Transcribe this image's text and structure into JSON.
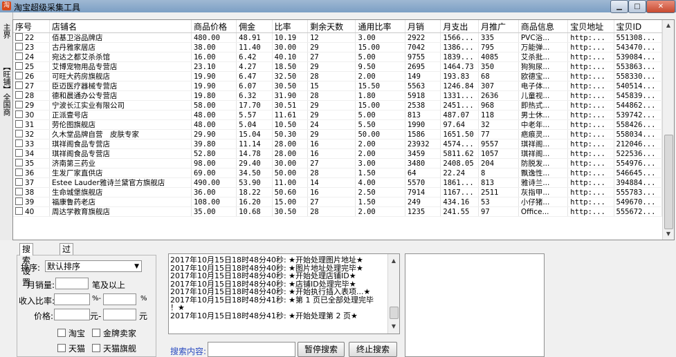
{
  "window": {
    "title": "淘宝超级采集工具",
    "icon": "app-icon",
    "controls": [
      "minimize-icon",
      "maximize-icon",
      "close-icon"
    ]
  },
  "side_tabs": [
    "主界",
    "【旺铺】全国商"
  ],
  "table": {
    "columns": [
      "序号",
      "店铺名",
      "商品价格",
      "佣金",
      "比率",
      "剩余天数",
      "通用比率",
      "月销",
      "月支出",
      "月推广",
      "商品信息",
      "宝贝地址",
      "宝贝ID"
    ],
    "rows": [
      [
        "22",
        "佰基卫浴品牌店",
        "480.00",
        "48.91",
        "10.19",
        "12",
        "3.00",
        "2922",
        "1566...",
        "335",
        "PVC浴...",
        "http:...",
        "551308..."
      ],
      [
        "23",
        "古丹雅家居店",
        "38.00",
        "11.40",
        "30.00",
        "29",
        "15.00",
        "7042",
        "1386...",
        "795",
        "万能弹...",
        "http:...",
        "543470..."
      ],
      [
        "24",
        "宛达之都艾杀杀馆",
        "16.00",
        "6.42",
        "40.10",
        "27",
        "5.00",
        "9755",
        "1839...",
        "4085",
        "艾杀批...",
        "http:...",
        "539084..."
      ],
      [
        "25",
        "艾博宠物用品专营店",
        "23.10",
        "4.27",
        "18.50",
        "29",
        "9.50",
        "2695",
        "1464.73",
        "350",
        "狗狗尿...",
        "http:...",
        "553863..."
      ],
      [
        "26",
        "可旺大药房旗舰店",
        "19.90",
        "6.47",
        "32.50",
        "28",
        "2.00",
        "149",
        "193.83",
        "68",
        "欧德宝...",
        "http:...",
        "558330..."
      ],
      [
        "27",
        "臣迈医疗器械专营店",
        "19.90",
        "6.07",
        "30.50",
        "15",
        "15.50",
        "5563",
        "1246.84",
        "307",
        "电子体...",
        "http:...",
        "540514..."
      ],
      [
        "28",
        "德和晨通办公专营店",
        "19.80",
        "6.32",
        "31.90",
        "28",
        "1.80",
        "5918",
        "1331...",
        "2636",
        "儿童视...",
        "http:...",
        "545839..."
      ],
      [
        "29",
        "宁波长江实业有限公司",
        "58.00",
        "17.70",
        "30.51",
        "29",
        "15.00",
        "2538",
        "2451...",
        "968",
        "即热式...",
        "http:...",
        "544862..."
      ],
      [
        "30",
        "正派壹号店",
        "48.00",
        "5.57",
        "11.61",
        "29",
        "5.00",
        "813",
        "487.07",
        "118",
        "男士休...",
        "http:...",
        "539742..."
      ],
      [
        "31",
        "劳伦图旗舰店",
        "48.00",
        "5.04",
        "10.50",
        "24",
        "5.50",
        "1990",
        "97.64",
        "32",
        "中老年...",
        "http:...",
        "558426..."
      ],
      [
        "32",
        "久木堂品牌自营　皮肤专家",
        "29.90",
        "15.04",
        "50.30",
        "29",
        "50.00",
        "1586",
        "1651.50",
        "77",
        "疤痕灵...",
        "http:...",
        "558034..."
      ],
      [
        "33",
        "琪祥阁食品专营店",
        "39.80",
        "11.14",
        "28.00",
        "16",
        "2.00",
        "23932",
        "4574...",
        "9557",
        "琪祥阁...",
        "http:...",
        "212046..."
      ],
      [
        "34",
        "琪祥阁食品专营店",
        "52.80",
        "14.78",
        "28.00",
        "16",
        "2.00",
        "3459",
        "5811.62",
        "1057",
        "琪祥阁...",
        "http:...",
        "522536..."
      ],
      [
        "35",
        "济南第三药业",
        "98.00",
        "29.40",
        "30.00",
        "27",
        "3.00",
        "3480",
        "2408.05",
        "204",
        "防脱发...",
        "http:...",
        "554976..."
      ],
      [
        "36",
        "生发厂家直供店",
        "69.00",
        "34.50",
        "50.00",
        "28",
        "1.50",
        "64",
        "22.24",
        "8",
        "飘逸性...",
        "http:...",
        "546645..."
      ],
      [
        "37",
        "Estee Lauder雅诗兰黛官方旗舰店",
        "490.00",
        "53.90",
        "11.00",
        "14",
        "4.00",
        "5570",
        "1861...",
        "813",
        "雅诗兰...",
        "http:...",
        "394884..."
      ],
      [
        "38",
        "生命城堡旗舰店",
        "36.00",
        "18.22",
        "50.60",
        "16",
        "2.50",
        "7914",
        "1167...",
        "2511",
        "灰指甲...",
        "http:...",
        "555783..."
      ],
      [
        "39",
        "福康鲁药老店",
        "108.00",
        "16.20",
        "15.00",
        "27",
        "1.50",
        "249",
        "434.16",
        "53",
        "小仔猪...",
        "http:...",
        "549670..."
      ],
      [
        "40",
        "周达学教育旗舰店",
        "35.00",
        "10.68",
        "30.50",
        "28",
        "2.00",
        "1235",
        "241.55",
        "97",
        "Office...",
        "http:...",
        "555672..."
      ]
    ]
  },
  "bottom_tabs": [
    "搜索设置",
    "过滤选项"
  ],
  "settings": {
    "sort_label": "排序:",
    "sort_value": "默认排序",
    "monthly_sales_label": "月销量:",
    "monthly_sales_suffix": "笔及以上",
    "income_ratio_label": "收入比率:",
    "percent": "%",
    "dash_percent": "%-",
    "price_label": "价格:",
    "yuan": "元",
    "dash_yuan": "元-",
    "checkboxes": [
      "淘宝",
      "金牌卖家",
      "天猫",
      "天猫旗舰"
    ]
  },
  "log": [
    "2017年10月15日18时48分40秒: ★开始处理图片地址★",
    "2017年10月15日18时48分40秒: ★图片地址处理完毕★",
    "2017年10月15日18时48分40秒: ★开始处理店铺ID★",
    "2017年10月15日18时48分40秒: ★店铺ID处理完毕★",
    "2017年10月15日18时48分40秒: ★开始执行插入表项...★",
    "2017年10月15日18时48分41秒: ★第 1 页已全部处理完毕",
    "！★",
    "2017年10月15日18时48分41秒: ★开始处理第 2 页★"
  ],
  "search": {
    "label": "搜索内容:",
    "pause_button": "暂停搜索",
    "stop_button": "终止搜索"
  }
}
